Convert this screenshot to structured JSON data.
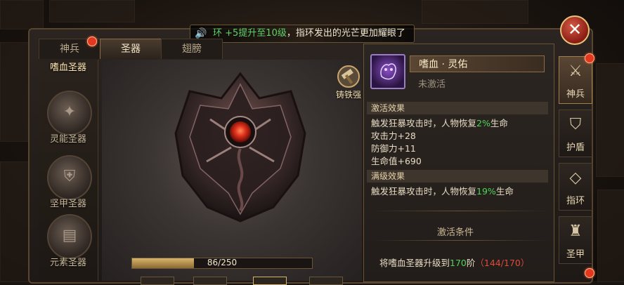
{
  "notice": {
    "prefix": "环 +5提升至",
    "level": "10级",
    "suffix": "，指环发出的光芒更加耀眼了"
  },
  "tabs": [
    {
      "label": "神兵",
      "dot": true
    },
    {
      "label": "圣器",
      "active": true
    },
    {
      "label": "翅膀"
    }
  ],
  "categories": [
    {
      "label": "嗜血圣器",
      "active": true
    },
    {
      "label": "灵能圣器"
    },
    {
      "label": "坚甲圣器"
    },
    {
      "label": "元素圣器"
    }
  ],
  "forge": {
    "label": "铸铁强"
  },
  "progress": {
    "text": "86/250",
    "current": 86,
    "max": 250
  },
  "detail": {
    "name": "嗜血 · 灵佑",
    "status": "未激活",
    "activate_title": "激活效果",
    "activate_lines": [
      {
        "pre": "触发狂暴攻击时，人物恢复",
        "val": "2%",
        "post": "生命"
      },
      {
        "pre": "攻击力+28"
      },
      {
        "pre": "防御力+11"
      },
      {
        "pre": "生命值+690"
      }
    ],
    "max_title": "满级效果",
    "max_line": {
      "pre": "触发狂暴攻击时，人物恢复",
      "val": "19%",
      "post": "生命"
    },
    "condition_title": "激活条件",
    "condition": {
      "pre": "将嗜血圣器升级到",
      "target": "170",
      "unit": "阶",
      "current": "（144/170）"
    }
  },
  "rightnav": [
    {
      "label": "神兵",
      "icon": "sword-icon",
      "active": true,
      "dot": true
    },
    {
      "label": "护盾",
      "icon": "shield-icon"
    },
    {
      "label": "指环",
      "icon": "ring-icon"
    },
    {
      "label": "圣甲",
      "icon": "armor-icon"
    }
  ],
  "colors": {
    "accent": "#8a6d45",
    "green": "#4fd35b",
    "red": "#e04a3a",
    "dot": "#e3381f"
  }
}
